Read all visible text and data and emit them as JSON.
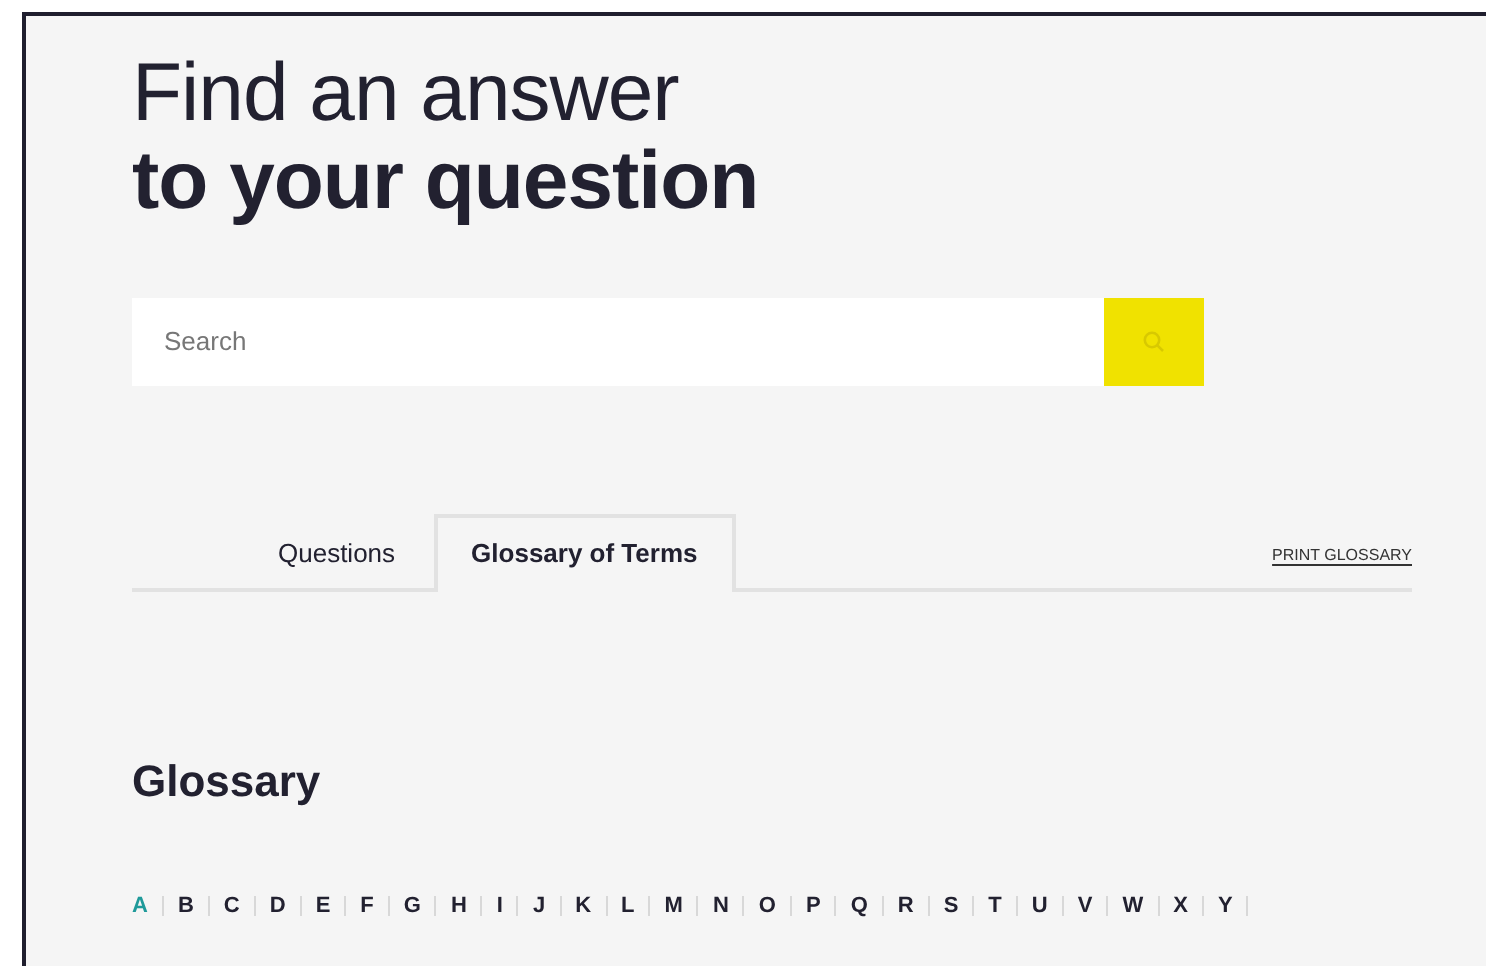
{
  "heading": {
    "line_1": "Find an answer",
    "line_2": "to your question"
  },
  "search": {
    "placeholder": "Search"
  },
  "tabs": [
    {
      "label": "Questions",
      "selected": false
    },
    {
      "label": "Glossary of Terms",
      "selected": true
    }
  ],
  "print_link": "PRINT GLOSSARY",
  "glossary": {
    "title": "Glossary",
    "letters": [
      {
        "label": "A",
        "selected": true
      },
      {
        "label": "B",
        "selected": false
      },
      {
        "label": "C",
        "selected": false
      },
      {
        "label": "D",
        "selected": false
      },
      {
        "label": "E",
        "selected": false
      },
      {
        "label": "F",
        "selected": false
      },
      {
        "label": "G",
        "selected": false
      },
      {
        "label": "H",
        "selected": false
      },
      {
        "label": "I",
        "selected": false
      },
      {
        "label": "J",
        "selected": false
      },
      {
        "label": "K",
        "selected": false
      },
      {
        "label": "L",
        "selected": false
      },
      {
        "label": "M",
        "selected": false
      },
      {
        "label": "N",
        "selected": false
      },
      {
        "label": "O",
        "selected": false
      },
      {
        "label": "P",
        "selected": false
      },
      {
        "label": "Q",
        "selected": false
      },
      {
        "label": "R",
        "selected": false
      },
      {
        "label": "S",
        "selected": false
      },
      {
        "label": "T",
        "selected": false
      },
      {
        "label": "U",
        "selected": false
      },
      {
        "label": "V",
        "selected": false
      },
      {
        "label": "W",
        "selected": false
      },
      {
        "label": "X",
        "selected": false
      },
      {
        "label": "Y",
        "selected": false
      }
    ]
  }
}
